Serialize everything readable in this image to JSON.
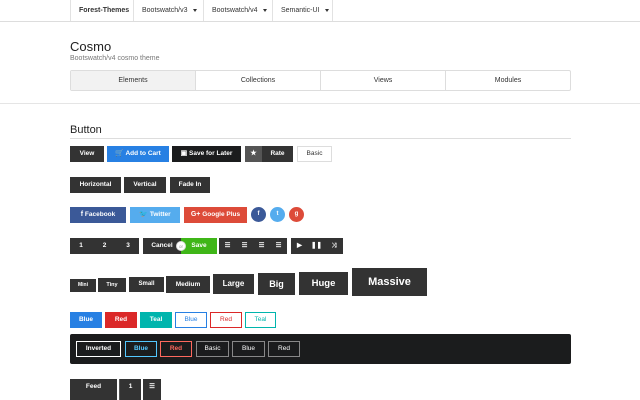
{
  "topnav": {
    "brand": "Forest-Themes",
    "items": [
      "Bootswatch/v3",
      "Bootswatch/v4",
      "Semantic-UI"
    ]
  },
  "header": {
    "title": "Cosmo",
    "subtitle": "Bootswatch/v4 cosmo theme"
  },
  "tabs": [
    "Elements",
    "Collections",
    "Views",
    "Modules"
  ],
  "section": {
    "title": "Button"
  },
  "row1": {
    "view": "View",
    "add_to_cart": "Add to Cart",
    "save_for_later": "Save for Later",
    "rate": "Rate",
    "basic": "Basic"
  },
  "row2": [
    "Horizontal",
    "Vertical",
    "Fade In"
  ],
  "social": {
    "facebook": "Facebook",
    "twitter": "Twitter",
    "google_plus": "Google Plus"
  },
  "row4": {
    "numbers": [
      "1",
      "2",
      "3"
    ],
    "cancel": "Cancel",
    "or": "or",
    "save": "Save"
  },
  "sizes": [
    "Mini",
    "Tiny",
    "Small",
    "Medium",
    "Large",
    "Big",
    "Huge",
    "Massive"
  ],
  "colors": [
    "Blue",
    "Red",
    "Teal",
    "Blue",
    "Red",
    "Teal"
  ],
  "inverted": [
    "Inverted",
    "Blue",
    "Red",
    "Basic",
    "Blue",
    "Red"
  ],
  "last_row": {
    "feed": "Feed",
    "one": "1"
  }
}
